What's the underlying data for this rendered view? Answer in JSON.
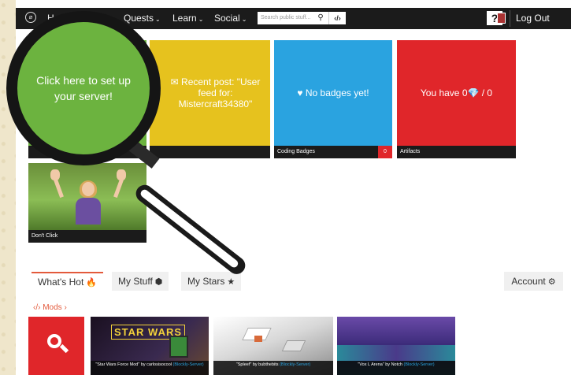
{
  "nav": {
    "home_icon": "home-icon",
    "home_label": "H",
    "items": [
      {
        "label": "Quests"
      },
      {
        "label": "Learn"
      },
      {
        "label": "Social"
      }
    ],
    "caret": "⌄",
    "search_placeholder": "Search public stuff...",
    "search_icon": "search-icon",
    "code_label": "‹/›",
    "help_label": "?",
    "logout_label": "Log Out"
  },
  "tiles": {
    "server": {
      "text": "Click here to set up your server!",
      "color": "#6cb33f"
    },
    "recent": {
      "text": "✉ Recent post: \"User feed for: Mistercraft34380\"",
      "color": "#e6c21e"
    },
    "badges": {
      "text": "♥ No badges yet!",
      "caption": "Coding Badges",
      "count": "0",
      "color": "#2aa3e0"
    },
    "artifacts": {
      "text": "You have 0💎 / 0",
      "caption": "Artifacts",
      "color": "#e0262a"
    },
    "video": {
      "caption": "Don't Click"
    }
  },
  "tabs": [
    {
      "label": "What's Hot",
      "icon": "🔥",
      "active": true
    },
    {
      "label": "My Stuff",
      "icon": "⬢",
      "active": false
    },
    {
      "label": "My Stars",
      "icon": "★",
      "active": false
    }
  ],
  "account": {
    "label": "Account",
    "icon": "⚙"
  },
  "mods_link": {
    "label": "‹/› Mods ›"
  },
  "mods": [
    {
      "title": "\"Star Wars Force Mod\" by carlosisocool",
      "server": "(Blockly-Server)",
      "thumb_text": "STAR WARS"
    },
    {
      "title": "\"Spleef\" by bubthebits",
      "server": "(Blockly-Server)"
    },
    {
      "title": "\"Vox L Arena\" by Notch",
      "server": "(Blockly-Server)"
    }
  ]
}
